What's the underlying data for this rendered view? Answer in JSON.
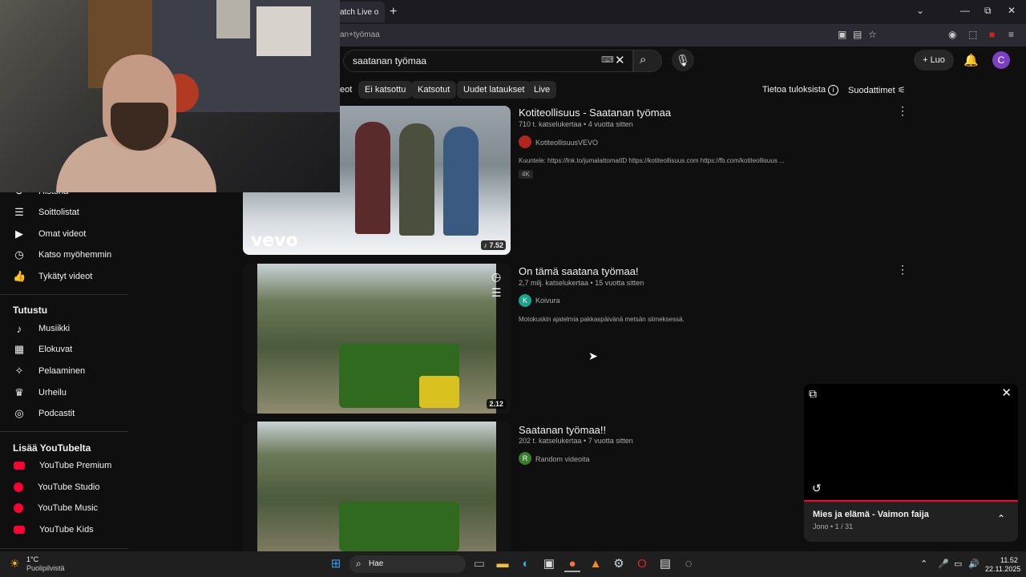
{
  "browser": {
    "tab_title": "atch Live o",
    "new_tab_symbol": "+",
    "url": "an+työmaa",
    "window_controls": [
      "⌄",
      "—",
      "⧉",
      "✕"
    ]
  },
  "header": {
    "search_value": "saatanan työmaa",
    "create_label": "Luo",
    "avatar_letter": "C"
  },
  "chips": [
    "eot",
    "Ei katsottu",
    "Katsotut",
    "Uudet lataukset",
    "Live"
  ],
  "toolbar": {
    "about_results": "Tietoa tuloksista",
    "filters": "Suodattimet"
  },
  "sidebar": {
    "you_items": [
      {
        "label": "Historia",
        "icon": "history-icon"
      },
      {
        "label": "Soittolistat",
        "icon": "playlist-icon"
      },
      {
        "label": "Omat videot",
        "icon": "video-icon"
      },
      {
        "label": "Katso myöhemmin",
        "icon": "clock-icon"
      },
      {
        "label": "Tykätyt videot",
        "icon": "like-icon"
      }
    ],
    "explore_title": "Tutustu",
    "explore_items": [
      {
        "label": "Musiikki",
        "icon": "music-icon"
      },
      {
        "label": "Elokuvat",
        "icon": "film-icon"
      },
      {
        "label": "Pelaaminen",
        "icon": "gaming-icon"
      },
      {
        "label": "Urheilu",
        "icon": "trophy-icon"
      },
      {
        "label": "Podcastit",
        "icon": "podcast-icon"
      }
    ],
    "more_title": "Lisää YouTubelta",
    "more_items": [
      {
        "label": "YouTube Premium"
      },
      {
        "label": "YouTube Studio"
      },
      {
        "label": "YouTube Music"
      },
      {
        "label": "YouTube Kids"
      }
    ]
  },
  "results": [
    {
      "title": "Kotiteollisuus - Saatanan työmaa",
      "meta": "710 t. katselukertaa • 4 vuotta sitten",
      "channel": "KotiteollisuusVEVO",
      "description": "Kuuntele: https://lnk.to/jumalattomatID https://kotiteollisuus.com https://fb.com/kotiteollisuus ...",
      "badge": "4K",
      "duration": "7.52",
      "watermark": "vevo"
    },
    {
      "title": "On tämä saatana työmaa!",
      "meta": "2,7 milj. katselukertaa • 15 vuotta sitten",
      "channel": "Koivura",
      "channel_initial": "K",
      "description": "Motokuskin ajatelmia pakkaspäivänä metsän siimeksessä.",
      "duration": "2.12"
    },
    {
      "title": "Saatanan työmaa!!",
      "meta": "202 t. katselukertaa • 7 vuotta sitten",
      "channel": "Random videoita",
      "channel_initial": "R"
    }
  ],
  "miniplayer": {
    "title": "Mies ja elämä - Vaimon faija",
    "queue": "Jono • 1 / 31"
  },
  "taskbar": {
    "weather_temp": "1°C",
    "weather_desc": "Puolipilvistä",
    "search_placeholder": "Hae",
    "time": "11.52",
    "date": "22.11.2025"
  },
  "colors": {
    "background": "#0f0f0f",
    "accent": "#ff0033",
    "avatar": "#7b3fc4"
  }
}
